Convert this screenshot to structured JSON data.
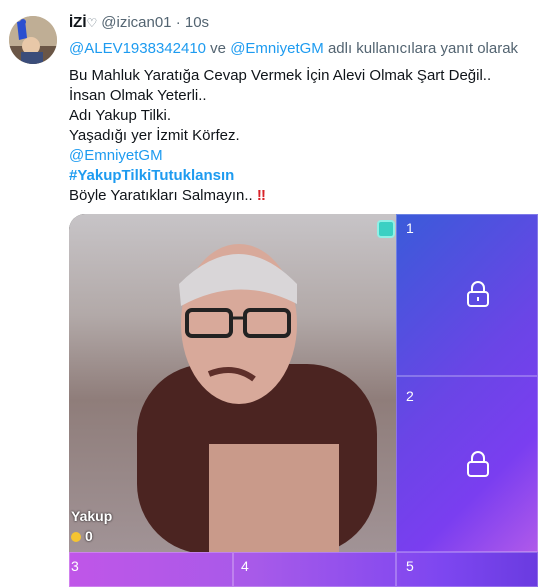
{
  "tweet": {
    "name": "İZİ",
    "handle": "@izican01",
    "separator": "·",
    "time": "10s",
    "reply_mention_1": "@ALEV1938342410",
    "reply_and": " ve ",
    "reply_mention_2": "@EmniyetGM",
    "reply_suffix": " adlı kullanıcılara yanıt olarak",
    "lines": [
      "Bu Mahluk Yaratığa Cevap Vermek İçin Alevi Olmak Şart Değil..",
      "İnsan Olmak Yeterli..",
      "Adı Yakup Tilki.",
      "Yaşadığı yer İzmit Körfez."
    ],
    "mention": "@EmniyetGM",
    "hashtag": "#YakupTilkiTutuklansın",
    "last_line": "Böyle Yaratıkları Salmayın..",
    "bang": "‼"
  },
  "media": {
    "video_user": "Yakup",
    "video_coins": "0",
    "slots": [
      {
        "num": "1",
        "locked": true
      },
      {
        "num": "2",
        "locked": true
      },
      {
        "num": "3",
        "locked": false
      },
      {
        "num": "4",
        "locked": false
      },
      {
        "num": "5",
        "locked": false
      }
    ]
  }
}
